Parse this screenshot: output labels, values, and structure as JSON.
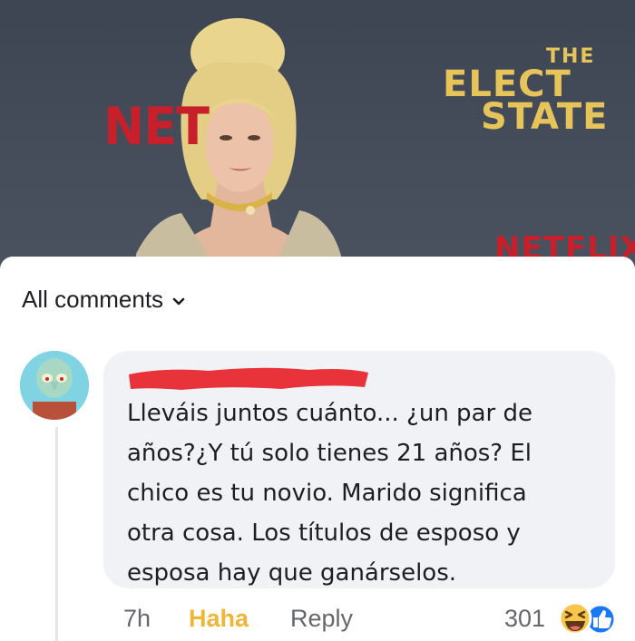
{
  "photo": {
    "brand_left": "NET",
    "title_the": "THE",
    "title_line1": "ELECT",
    "title_line2": "STATE",
    "brand_bottom": "NETFLIX"
  },
  "comments": {
    "header_label": "All comments",
    "comment": {
      "text": "Lleváis juntos cuánto... ¿un par de\naños?¿Y tú solo tienes 21 años? El\nchico es tu novio. Marido significa\notra cosa. Los  títulos de esposo y\nesposa hay que ganárselos.",
      "time": "7h",
      "reaction_label": "Haha",
      "reply_label": "Reply",
      "reaction_count": "301",
      "reaction_icons": [
        "haha-emoji-icon",
        "like-icon"
      ]
    }
  },
  "colors": {
    "haha_accent": "#f0b536",
    "like_blue": "#1877f2",
    "bubble_bg": "#f0f2f5",
    "redaction_red": "#e8333a"
  }
}
